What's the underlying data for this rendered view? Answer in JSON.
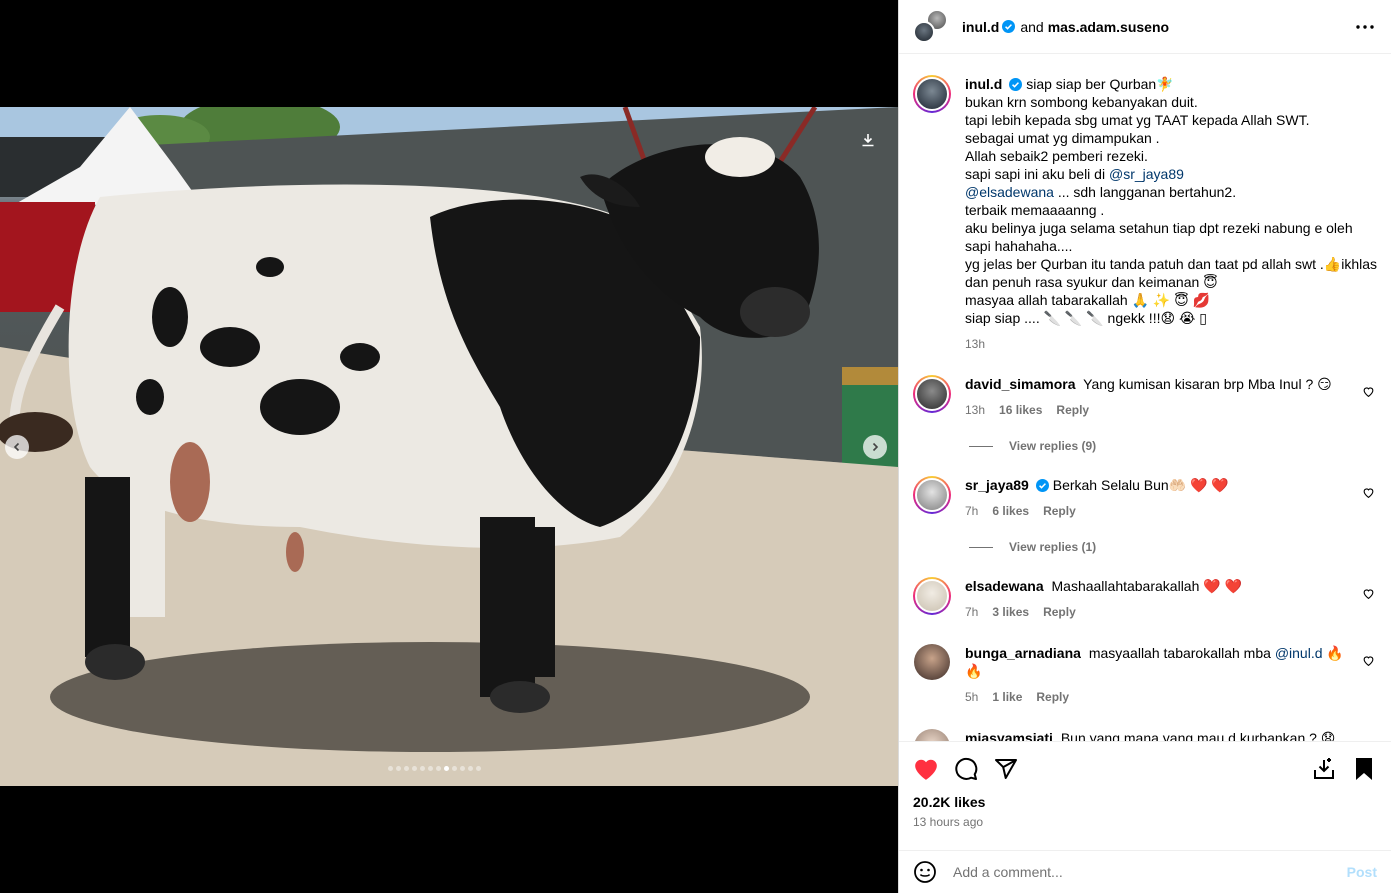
{
  "header": {
    "user1": "inul.d",
    "and": "and",
    "user2": "mas.adam.suseno"
  },
  "caption": {
    "username": "inul.d",
    "line1": "siap siap ber Qurban🧚",
    "line2": "bukan krn sombong kebanyakan duit.",
    "line3": "tapi lebih kepada sbg umat yg TAAT kepada Allah SWT.",
    "line4": "sebagai umat yg dimampukan .",
    "line5": "Allah sebaik2 pemberi rezeki.",
    "line6_pre": "sapi sapi ini aku beli di ",
    "line6_mention": "@sr_jaya89",
    "line7_mention": "@elsadewana",
    "line7_post": " ... sdh langganan bertahun2.",
    "line8": "terbaik memaaaanng .",
    "line9": "aku belinya juga selama setahun tiap dpt rezeki nabung e oleh sapi hahahaha....",
    "line10": "yg jelas ber Qurban itu tanda patuh dan taat pd allah swt .👍ikhlas dan penuh rasa syukur dan keimanan 😇",
    "line11": "masyaa allah tabarakallah 🙏 ✨ 😇 💋",
    "line12": "siap siap .... 🔪 🔪 🔪 ngekk !!!😧 😭 ▯",
    "time": "13h"
  },
  "comments": [
    {
      "username": "david_simamora",
      "text": "Yang kumisan kisaran brp Mba Inul ? 😏",
      "time": "13h",
      "likes": "16 likes",
      "reply": "Reply",
      "view_replies": "View replies (9)"
    },
    {
      "username": "sr_jaya89",
      "text": "Berkah Selalu Bun🤲🏻 ❤️ ❤️",
      "time": "7h",
      "likes": "6 likes",
      "reply": "Reply",
      "view_replies": "View replies (1)"
    },
    {
      "username": "elsadewana",
      "text": "Mashaallahtabarakallah ❤️ ❤️",
      "time": "7h",
      "likes": "3 likes",
      "reply": "Reply"
    },
    {
      "username": "bunga_arnadiana",
      "text_pre": "masyaallah tabarokallah mba ",
      "mention": "@inul.d",
      "text_post": " 🔥🔥",
      "time": "5h",
      "likes": "1 like",
      "reply": "Reply"
    },
    {
      "username": "miasyamsiati",
      "text": "Bun yang mana yang mau d kurbankan ? 😧 😧 😂"
    }
  ],
  "likes": "20.2K likes",
  "posted": "13 hours ago",
  "add_comment": {
    "placeholder": "Add a comment...",
    "post": "Post"
  },
  "carousel": {
    "total": 12,
    "active": 8
  },
  "colors": {
    "like": "#ff3040",
    "verified": "#0095f6",
    "mention": "#00376b"
  }
}
